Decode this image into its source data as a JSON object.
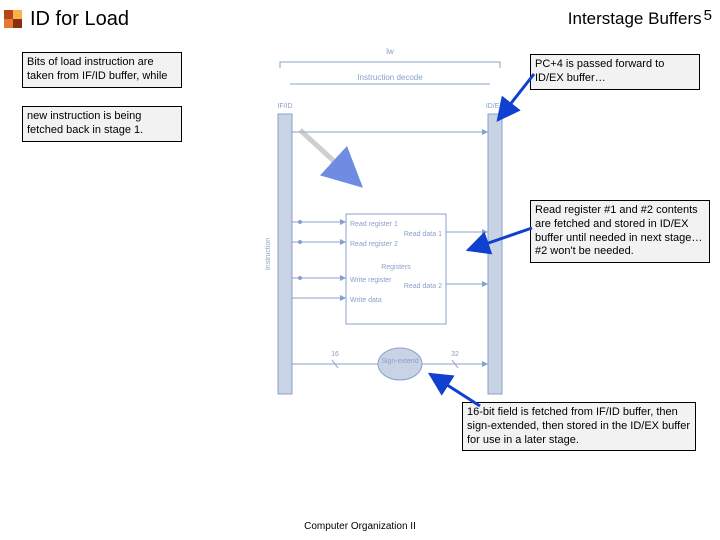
{
  "header": {
    "title": "ID for Load",
    "right": "Interstage Buffers",
    "page": "5"
  },
  "annots": {
    "a1": "Bits of load instruction are taken from IF/ID buffer, while",
    "a2": "new instruction is being fetched back in stage 1.",
    "a3": "PC+4 is passed forward to ID/EX buffer…",
    "a4": "Read register #1 and #2 contents are fetched and stored in ID/EX buffer until needed in next stage… #2 won't be needed.",
    "a5": "16-bit field is fetched from IF/ID buffer, then sign-extended, then stored in the ID/EX buffer for use in a later stage."
  },
  "diagram": {
    "top_label": "lw",
    "stage_label": "Instruction decode",
    "buf_left": "IF/ID",
    "buf_right": "ID/EX",
    "regfile_title": "Registers",
    "rf_ports": {
      "rr1": "Read register 1",
      "rr2": "Read register 2",
      "wr": "Write register",
      "wd": "Write data",
      "rd1": "Read data 1",
      "rd2": "Read data 2"
    },
    "signext": "Sign-extend",
    "signext_in": "16",
    "signext_out": "32",
    "inst_side": "Instruction"
  },
  "footer": "Computer Organization II"
}
